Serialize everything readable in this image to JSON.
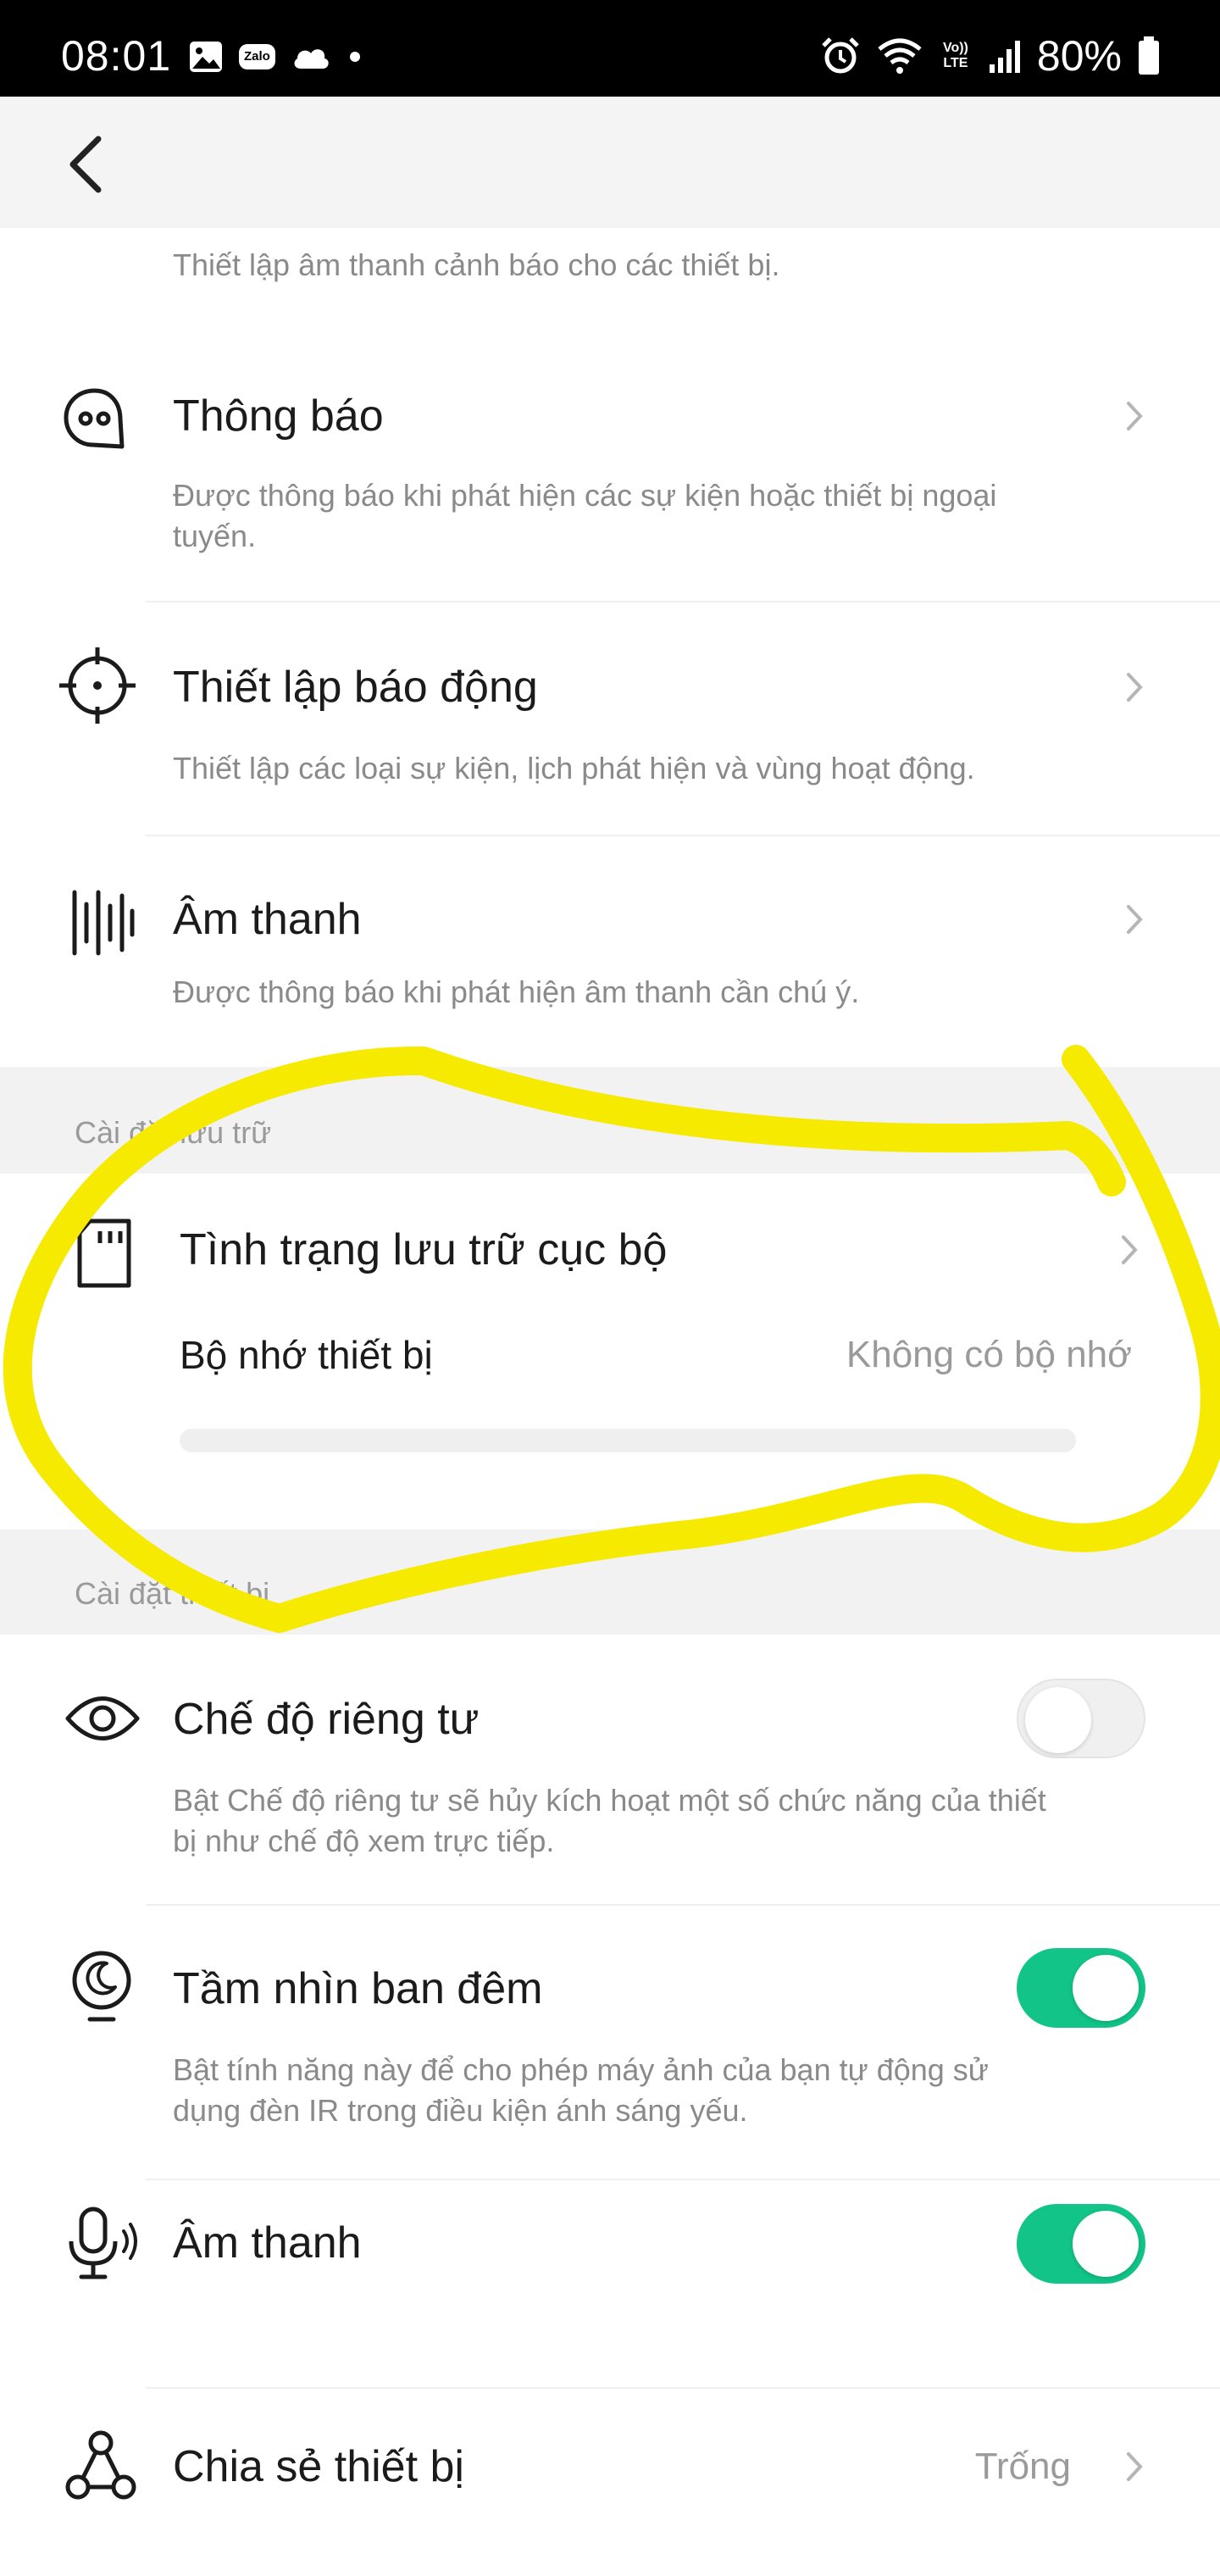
{
  "status_bar": {
    "time": "08:01",
    "zalo_label": "Zalo",
    "lte_label": "Vo)) LTE",
    "battery_percent": "80%"
  },
  "header": {
    "back_icon": "chevron-left-icon"
  },
  "alarm_sound_card": {
    "description": "Thiết lập âm thanh cảnh báo cho các thiết bị."
  },
  "notifications": {
    "title": "Thông báo",
    "description": "Được thông báo khi phát hiện các sự kiện hoặc thiết bị ngoại tuyến.",
    "icon": "chat-bubble-icon"
  },
  "alarm_settings": {
    "title": "Thiết lập báo động",
    "description": "Thiết lập các loại sự kiện, lịch phát hiện và vùng hoạt động.",
    "icon": "crosshair-icon"
  },
  "sound_detection": {
    "title": "Âm thanh",
    "description": "Được thông báo khi phát hiện âm thanh cần chú ý.",
    "icon": "sound-wave-icon"
  },
  "storage_section": {
    "label": "Cài đặt lưu trữ",
    "local_storage_title": "Tình trạng lưu trữ cục bộ",
    "device_memory_label": "Bộ nhớ thiết bị",
    "device_memory_value": "Không có bộ nhớ",
    "storage_used_fraction": 0,
    "icon": "sd-card-icon"
  },
  "device_section": {
    "label": "Cài đặt thiết bị"
  },
  "privacy_mode": {
    "title": "Chế độ riêng tư",
    "description": "Bật Chế độ riêng tư sẽ hủy kích hoạt một số chức năng của thiết bị như chế độ xem trực tiếp.",
    "enabled": false,
    "icon": "eye-icon"
  },
  "night_vision": {
    "title": "Tầm nhìn ban đêm",
    "description": "Bật tính năng này để cho phép máy ảnh của bạn tự động sử dụng đèn IR trong điều kiện ánh sáng yếu.",
    "enabled": true,
    "icon": "night-mode-icon"
  },
  "audio": {
    "title": "Âm thanh",
    "enabled": true,
    "icon": "microphone-icon"
  },
  "share_device": {
    "title": "Chia sẻ thiết bị",
    "value": "Trống",
    "icon": "share-nodes-icon"
  },
  "colors": {
    "toggle_on": "#12c488",
    "annotation_highlight": "#f5ea00",
    "status_bar_bg": "#000000"
  }
}
